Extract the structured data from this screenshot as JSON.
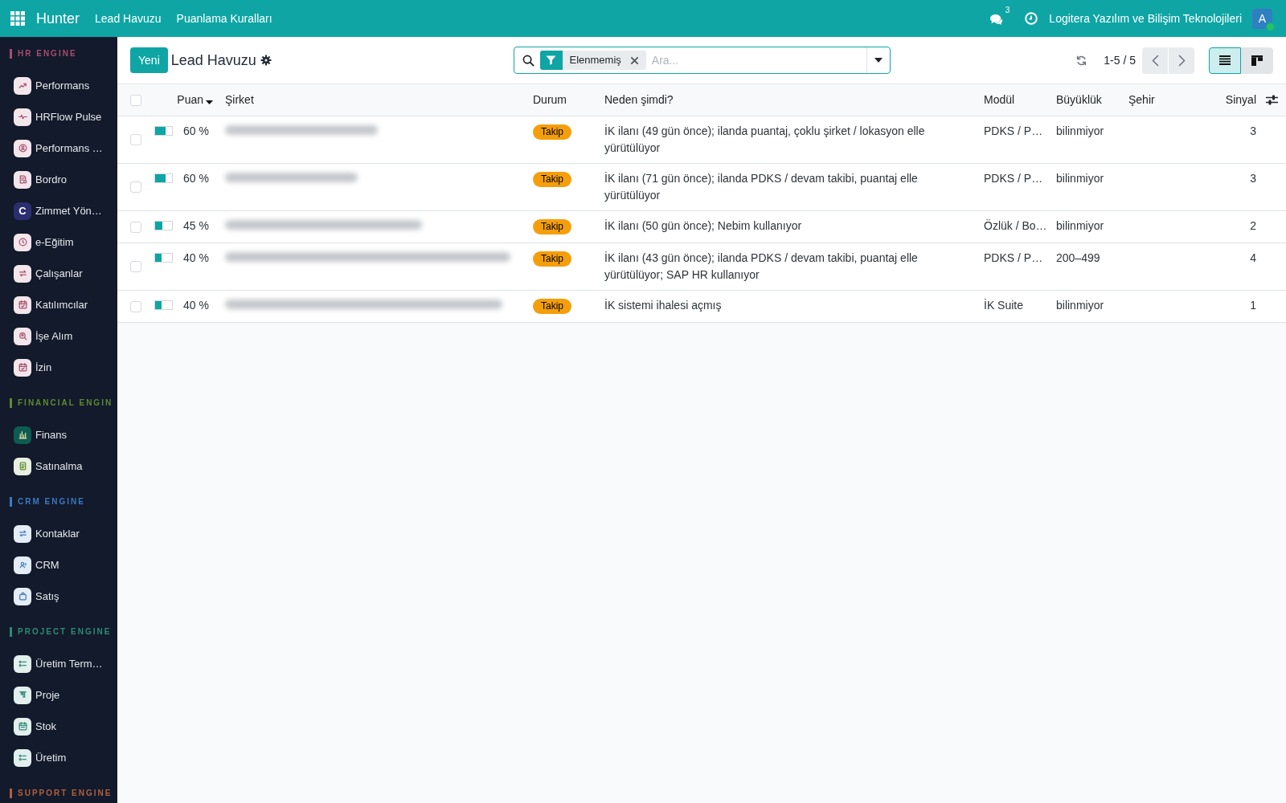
{
  "navbar": {
    "app_name": "Hunter",
    "menu": [
      {
        "label": "Lead Havuzu"
      },
      {
        "label": "Puanlama Kuralları"
      }
    ],
    "messages_count": "3",
    "company": "Logitera Yazılım ve Bilişim Teknolojileri",
    "avatar_initial": "A",
    "online": true
  },
  "sidebar": {
    "sections": [
      {
        "title": "HR ENGINE",
        "color": "#a64d6e",
        "items": [
          {
            "label": "Performans"
          },
          {
            "label": "HRFlow Pulse"
          },
          {
            "label": "Performans …"
          },
          {
            "label": "Bordro"
          },
          {
            "label": "Zimmet Yön…",
            "logo_letter": "C"
          },
          {
            "label": "e-Eğitim"
          },
          {
            "label": "Çalışanlar"
          },
          {
            "label": "Katılımcılar"
          },
          {
            "label": "İşe Alım"
          },
          {
            "label": "İzin"
          }
        ]
      },
      {
        "title": "FINANCIAL ENGIN",
        "color": "#5f8a2e",
        "items": [
          {
            "label": "Finans"
          },
          {
            "label": "Satınalma"
          }
        ]
      },
      {
        "title": "CRM ENGINE",
        "color": "#3d78c0",
        "items": [
          {
            "label": "Kontaklar"
          },
          {
            "label": "CRM"
          },
          {
            "label": "Satış"
          }
        ]
      },
      {
        "title": "PROJECT ENGINE",
        "color": "#2e8a76",
        "items": [
          {
            "label": "Üretim Term…"
          },
          {
            "label": "Proje"
          },
          {
            "label": "Stok"
          },
          {
            "label": "Üretim"
          }
        ]
      },
      {
        "title": "SUPPORT ENGINE",
        "color": "#b0603e"
      }
    ]
  },
  "control_panel": {
    "new_button": "Yeni",
    "title": "Lead Havuzu",
    "search": {
      "facets": [
        {
          "label": "Elenmemiş"
        }
      ],
      "placeholder": "Ara..."
    },
    "pager": "1-5 / 5",
    "views": [
      {
        "kind": "list",
        "selected": true
      },
      {
        "kind": "kanban",
        "selected": false
      }
    ]
  },
  "table": {
    "select_all": {
      "checked": false
    },
    "columns": [
      {
        "label": "Puan",
        "sorted": true
      },
      {
        "label": "Şirket",
        "sorted": false
      },
      {
        "label": "Durum",
        "sorted": false
      },
      {
        "label": "Neden şimdi?",
        "sorted": false
      },
      {
        "label": "Modül",
        "sorted": false
      },
      {
        "label": "Büyüklük",
        "sorted": false
      },
      {
        "label": "Şehir",
        "sorted": false
      },
      {
        "label": "Sinyal",
        "sorted": false
      }
    ],
    "rows": [
      {
        "selected": false,
        "level": 0.6,
        "score": "60 %",
        "company_blurred": true,
        "status": "Takip",
        "reason": "İK ilanı (49 gün önce); ilanda puantaj, çoklu şirket / lokasyon elle yürütülüyor",
        "module": "PDKS / P…",
        "size": "bilinmiyor",
        "signal": "3"
      },
      {
        "selected": false,
        "level": 0.6,
        "score": "60 %",
        "company_blurred": true,
        "status": "Takip",
        "reason": "İK ilanı (71 gün önce); ilanda PDKS / devam takibi, puantaj elle yürütülüyor",
        "module": "PDKS / P…",
        "size": "bilinmiyor",
        "signal": "3"
      },
      {
        "selected": false,
        "level": 0.45,
        "score": "45 %",
        "company_blurred": true,
        "status": "Takip",
        "reason": "İK ilanı (50 gün önce); Nebim kullanıyor",
        "module": "Özlük / Bo…",
        "size": "bilinmiyor",
        "signal": "2"
      },
      {
        "selected": false,
        "level": 0.4,
        "score": "40 %",
        "company_blurred": true,
        "status": "Takip",
        "reason": "İK ilanı (43 gün önce); ilanda PDKS / devam takibi, puantaj elle yürütülüyor; SAP HR kullanıyor",
        "module": "PDKS / P…",
        "size": "200–499",
        "signal": "4"
      },
      {
        "selected": false,
        "level": 0.4,
        "score": "40 %",
        "company_blurred": true,
        "status": "Takip",
        "reason": "İK sistemi ihalesi açmış",
        "module": "İK Suite",
        "size": "bilinmiyor",
        "signal": "1"
      }
    ]
  }
}
